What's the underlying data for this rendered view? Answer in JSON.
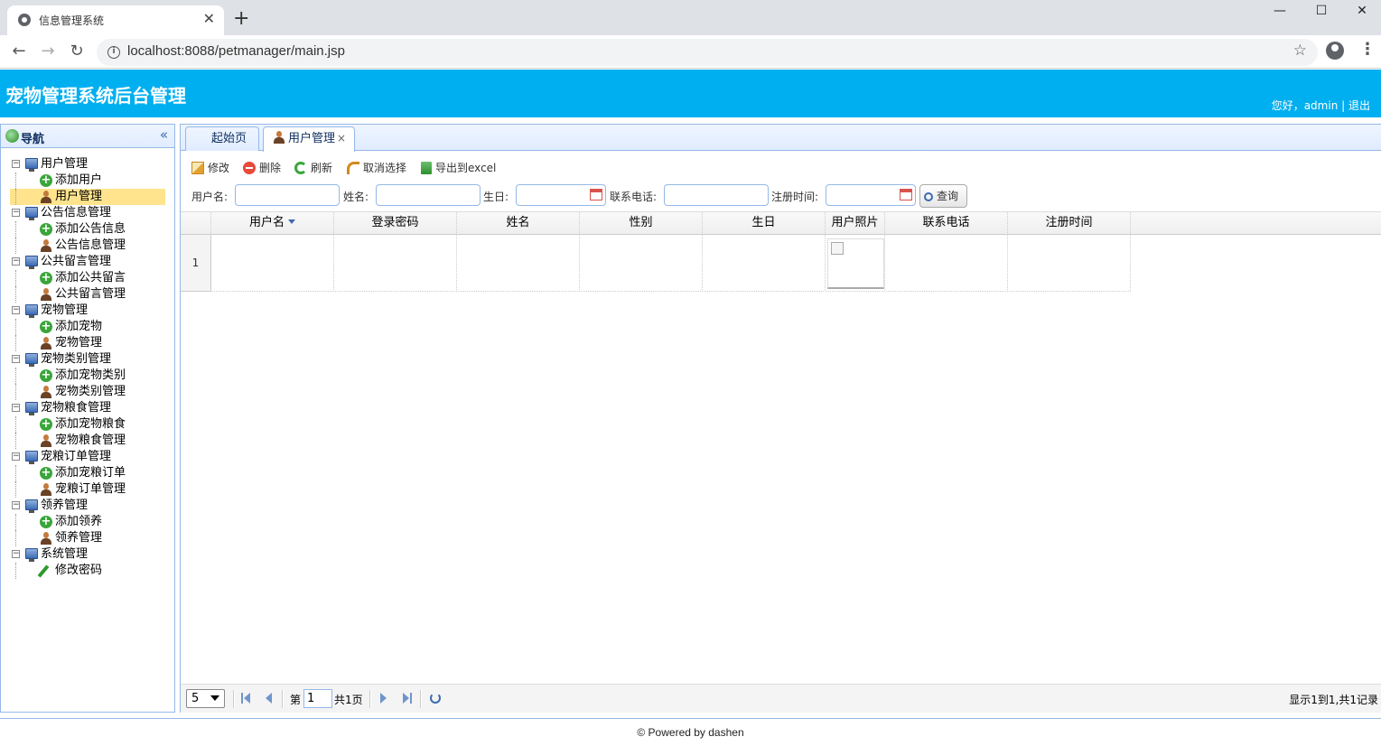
{
  "browser": {
    "tab_title": "信息管理系统",
    "tab_close": "✕",
    "new_tab": "+",
    "url": "localhost:8088/petmanager/main.jsp",
    "info_icon": "i",
    "star_icon": "☆",
    "win_min": "—",
    "win_max": "☐",
    "win_close": "✕",
    "back": "←",
    "forward": "→",
    "reload": "↻",
    "menu": "⋮"
  },
  "app": {
    "title": "宠物管理系统后台管理",
    "greeting": "您好，admin",
    "separator": " | ",
    "logout": "退出"
  },
  "nav": {
    "title": "导航",
    "collapse_icon": "«",
    "groups": [
      {
        "label": "用户管理",
        "children": [
          {
            "label": "添加用户",
            "icon": "add-icon"
          },
          {
            "label": "用户管理",
            "icon": "user-icon",
            "selected": true
          }
        ]
      },
      {
        "label": "公告信息管理",
        "children": [
          {
            "label": "添加公告信息",
            "icon": "add-icon"
          },
          {
            "label": "公告信息管理",
            "icon": "user-icon"
          }
        ]
      },
      {
        "label": "公共留言管理",
        "children": [
          {
            "label": "添加公共留言",
            "icon": "add-icon"
          },
          {
            "label": "公共留言管理",
            "icon": "user-icon"
          }
        ]
      },
      {
        "label": "宠物管理",
        "children": [
          {
            "label": "添加宠物",
            "icon": "add-icon"
          },
          {
            "label": "宠物管理",
            "icon": "user-icon"
          }
        ]
      },
      {
        "label": "宠物类别管理",
        "children": [
          {
            "label": "添加宠物类别",
            "icon": "add-icon"
          },
          {
            "label": "宠物类别管理",
            "icon": "user-icon"
          }
        ]
      },
      {
        "label": "宠物粮食管理",
        "children": [
          {
            "label": "添加宠物粮食",
            "icon": "add-icon"
          },
          {
            "label": "宠物粮食管理",
            "icon": "user-icon"
          }
        ]
      },
      {
        "label": "宠粮订单管理",
        "children": [
          {
            "label": "添加宠粮订单",
            "icon": "add-icon"
          },
          {
            "label": "宠粮订单管理",
            "icon": "user-icon"
          }
        ]
      },
      {
        "label": "领养管理",
        "children": [
          {
            "label": "添加领养",
            "icon": "add-icon"
          },
          {
            "label": "领养管理",
            "icon": "user-icon"
          }
        ]
      },
      {
        "label": "系统管理",
        "children": [
          {
            "label": "修改密码",
            "icon": "pencil-icon"
          }
        ]
      }
    ]
  },
  "tabs": [
    {
      "label": "起始页",
      "active": false
    },
    {
      "label": "用户管理",
      "active": true,
      "close": "×"
    }
  ],
  "toolbar": {
    "edit": "修改",
    "delete": "删除",
    "refresh": "刷新",
    "unselect": "取消选择",
    "export": "导出到excel"
  },
  "search": {
    "username_label": "用户名:",
    "name_label": "姓名:",
    "birthday_label": "生日:",
    "phone_label": "联系电话:",
    "regtime_label": "注册时间:",
    "query_button": "查询",
    "username_value": "",
    "name_value": "",
    "birthday_value": "",
    "phone_value": "",
    "regtime_value": ""
  },
  "grid": {
    "columns": [
      "用户名",
      "登录密码",
      "姓名",
      "性别",
      "生日",
      "用户照片",
      "联系电话",
      "注册时间"
    ],
    "rows": [
      {
        "num": "1",
        "cells": [
          "",
          "",
          "",
          "",
          "",
          "",
          "",
          ""
        ]
      }
    ]
  },
  "pager": {
    "page_size": "5",
    "page_prefix": "第",
    "page_value": "1",
    "page_total": "共1页",
    "info": "显示1到1,共1记录"
  },
  "footer": {
    "text": "© Powered by dashen"
  },
  "colors": {
    "header_bg": "#00aff0",
    "panel_border": "#95b8e7",
    "selected_row": "#ffe48d"
  }
}
